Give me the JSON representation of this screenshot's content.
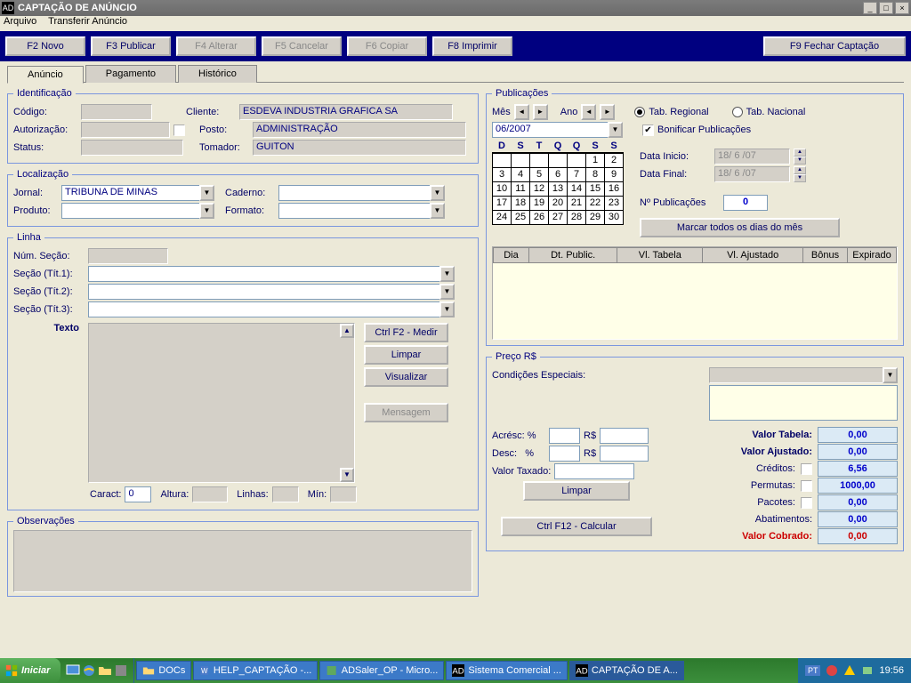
{
  "window": {
    "title": "CAPTAÇÃO DE ANÚNCIO"
  },
  "menu": {
    "arquivo": "Arquivo",
    "transferir": "Transferir Anúncio"
  },
  "toolbar": {
    "f2": "F2 Novo",
    "f3": "F3 Publicar",
    "f4": "F4 Alterar",
    "f5": "F5 Cancelar",
    "f6": "F6 Copiar",
    "f8": "F8 Imprimir",
    "f9": "F9 Fechar Captação"
  },
  "tabs": {
    "anuncio": "Anúncio",
    "pagamento": "Pagamento",
    "historico": "Histórico"
  },
  "ident": {
    "legend": "Identificação",
    "codigo_lbl": "Código:",
    "autorizacao_lbl": "Autorização:",
    "status_lbl": "Status:",
    "cliente_lbl": "Cliente:",
    "posto_lbl": "Posto:",
    "tomador_lbl": "Tomador:",
    "cliente": "ESDEVA INDUSTRIA GRAFICA SA",
    "posto": "ADMINISTRAÇÃO",
    "tomador": "GUITON"
  },
  "local": {
    "legend": "Localização",
    "jornal_lbl": "Jornal:",
    "caderno_lbl": "Caderno:",
    "produto_lbl": "Produto:",
    "formato_lbl": "Formato:",
    "jornal": "TRIBUNA DE MINAS"
  },
  "linha": {
    "legend": "Linha",
    "num_secao_lbl": "Núm. Seção:",
    "secao1_lbl": "Seção (Tít.1):",
    "secao2_lbl": "Seção (Tít.2):",
    "secao3_lbl": "Seção (Tít.3):",
    "texto_lbl": "Texto",
    "medir": "Ctrl F2 - Medir",
    "limpar": "Limpar",
    "visualizar": "Visualizar",
    "mensagem": "Mensagem",
    "caract_lbl": "Caract:",
    "caract": "0",
    "altura_lbl": "Altura:",
    "linhas_lbl": "Linhas:",
    "min_lbl": "Mín:"
  },
  "obs": {
    "legend": "Observações"
  },
  "pub": {
    "legend": "Publicações",
    "mes_lbl": "Mês",
    "ano_lbl": "Ano",
    "periodo": "06/2007",
    "tab_regional": "Tab. Regional",
    "tab_nacional": "Tab. Nacional",
    "bonificar": "Bonificar Publicações",
    "data_inicio_lbl": "Data Inicio:",
    "data_inicio": "18/ 6 /07",
    "data_final_lbl": "Data Final:",
    "data_final": "18/ 6 /07",
    "num_pub_lbl": "Nº Publicações",
    "num_pub": "0",
    "marcar": "Marcar todos os dias do mês",
    "dow": [
      "D",
      "S",
      "T",
      "Q",
      "Q",
      "S",
      "S"
    ],
    "grid_cols": [
      "Dia",
      "Dt. Public.",
      "Vl. Tabela",
      "Vl. Ajustado",
      "Bônus",
      "Expirado"
    ]
  },
  "preco": {
    "legend": "Preço R$",
    "cond_lbl": "Condições Especiais:",
    "acresc_lbl": "Acrésc: %",
    "rs": "R$",
    "desc_lbl": "Desc:   %",
    "valor_taxado_lbl": "Valor Taxado:",
    "limpar": "Limpar",
    "calcular": "Ctrl F12 - Calcular",
    "vtabela_lbl": "Valor Tabela:",
    "vtabela": "0,00",
    "vajustado_lbl": "Valor Ajustado:",
    "vajustado": "0,00",
    "creditos_lbl": "Créditos:",
    "creditos": "6,56",
    "permutas_lbl": "Permutas:",
    "permutas": "1000,00",
    "pacotes_lbl": "Pacotes:",
    "pacotes": "0,00",
    "abat_lbl": "Abatimentos:",
    "abat": "0,00",
    "cobrado_lbl": "Valor Cobrado:",
    "cobrado": "0,00"
  },
  "taskbar": {
    "start": "Iniciar",
    "items": [
      "DOCs",
      "HELP_CAPTAÇÃO -...",
      "ADSaler_OP - Micro...",
      "Sistema Comercial ...",
      "CAPTAÇÃO DE A..."
    ],
    "time": "19:56",
    "lang": "PT"
  }
}
